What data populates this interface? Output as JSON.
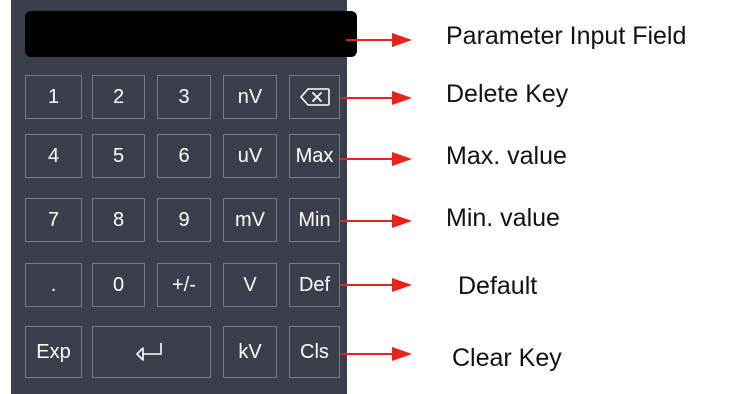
{
  "keypad": {
    "rows": [
      [
        "1",
        "2",
        "3",
        "nV",
        ""
      ],
      [
        "4",
        "5",
        "6",
        "uV",
        "Max"
      ],
      [
        "7",
        "8",
        "9",
        "mV",
        "Min"
      ],
      [
        ".",
        "0",
        "+/-",
        "V",
        "Def"
      ],
      [
        "Exp",
        "",
        "kV",
        "Cls"
      ]
    ],
    "icons": {
      "delete": "backspace-icon",
      "enter": "enter-icon"
    }
  },
  "annotations": {
    "input_field": "Parameter Input Field",
    "delete_key": "Delete Key",
    "max_value": "Max. value",
    "min_value": "Min. value",
    "default": "Default",
    "clear_key": "Clear Key"
  },
  "colors": {
    "panel": "#3a3f4b",
    "display": "#000000",
    "key_border": "#777c86",
    "key_text": "#ffffff",
    "arrow": "#e8231c"
  }
}
